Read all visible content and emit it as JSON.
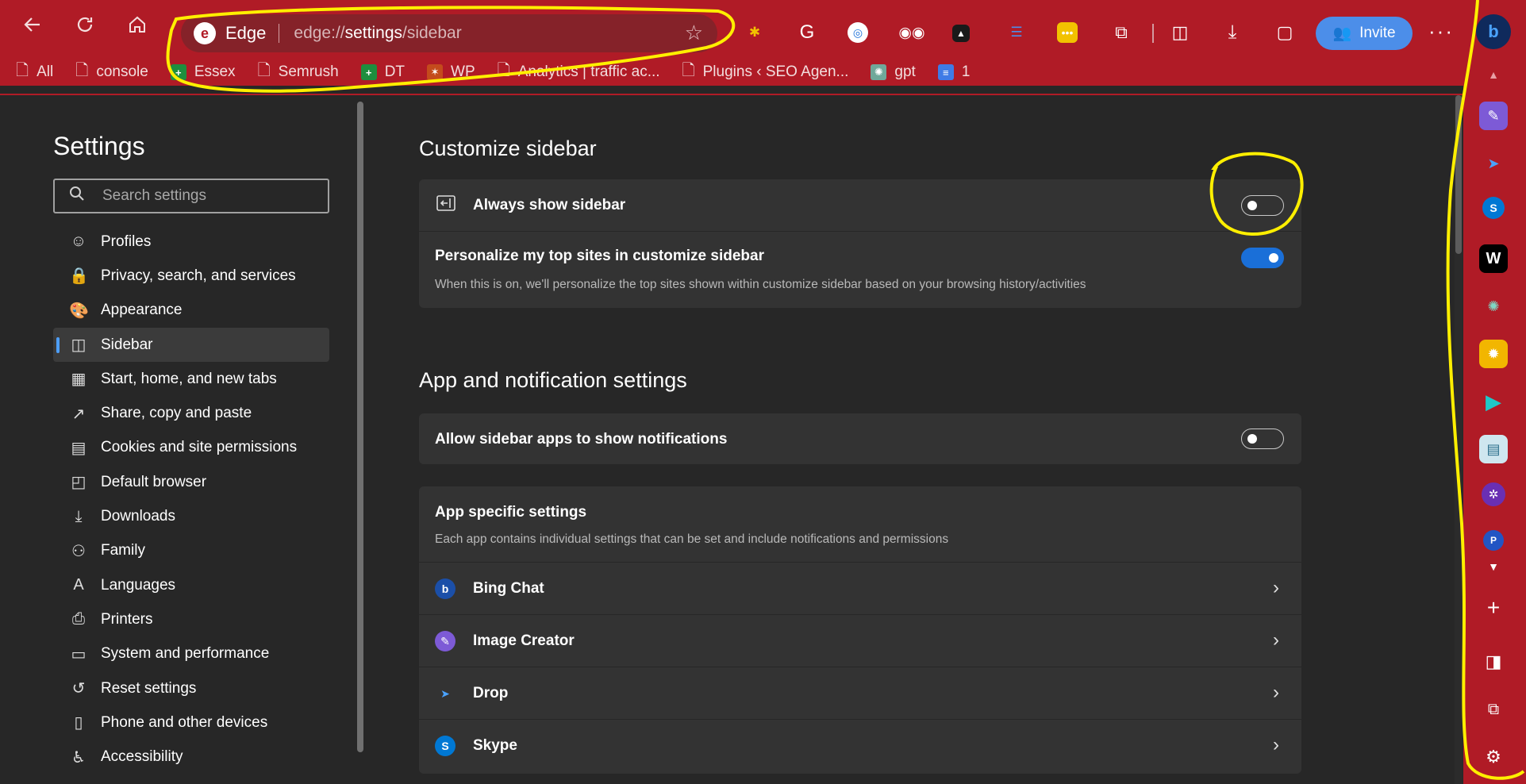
{
  "browser": {
    "brand": "Edge",
    "url_scheme": "edge://",
    "url_host": "settings",
    "url_path": "/sidebar",
    "invite_label": "Invite",
    "more_label": "···"
  },
  "bookmarks": [
    {
      "label": "All",
      "icon": "page-icon"
    },
    {
      "label": "console",
      "icon": "page-icon"
    },
    {
      "label": "Essex",
      "icon": "sheets-icon"
    },
    {
      "label": "Semrush",
      "icon": "page-icon"
    },
    {
      "label": "DT",
      "icon": "sheets-icon"
    },
    {
      "label": "WP",
      "icon": "multicolor-icon"
    },
    {
      "label": "Analytics | traffic ac...",
      "icon": "page-icon"
    },
    {
      "label": "Plugins ‹ SEO Agen...",
      "icon": "page-icon"
    },
    {
      "label": "gpt",
      "icon": "chatgpt-icon"
    },
    {
      "label": "1",
      "icon": "docs-icon"
    }
  ],
  "settings": {
    "title": "Settings",
    "search_placeholder": "Search settings",
    "nav": [
      {
        "label": "Profiles",
        "icon": "profile-icon"
      },
      {
        "label": "Privacy, search, and services",
        "icon": "lock-icon"
      },
      {
        "label": "Appearance",
        "icon": "palette-icon"
      },
      {
        "label": "Sidebar",
        "icon": "sidebar-icon",
        "active": true
      },
      {
        "label": "Start, home, and new tabs",
        "icon": "home-tabs-icon"
      },
      {
        "label": "Share, copy and paste",
        "icon": "share-icon"
      },
      {
        "label": "Cookies and site permissions",
        "icon": "cookies-icon"
      },
      {
        "label": "Default browser",
        "icon": "browser-icon"
      },
      {
        "label": "Downloads",
        "icon": "download-icon"
      },
      {
        "label": "Family",
        "icon": "family-icon"
      },
      {
        "label": "Languages",
        "icon": "languages-icon"
      },
      {
        "label": "Printers",
        "icon": "printer-icon"
      },
      {
        "label": "System and performance",
        "icon": "laptop-icon"
      },
      {
        "label": "Reset settings",
        "icon": "reset-icon"
      },
      {
        "label": "Phone and other devices",
        "icon": "phone-icon"
      },
      {
        "label": "Accessibility",
        "icon": "accessibility-icon"
      }
    ]
  },
  "customize": {
    "title": "Customize sidebar",
    "always_show_label": "Always show sidebar",
    "always_show_on": false,
    "personalize_label": "Personalize my top sites in customize sidebar",
    "personalize_desc": "When this is on, we'll personalize the top sites shown within customize sidebar based on your browsing history/activities",
    "personalize_on": true
  },
  "apps": {
    "title": "App and notification settings",
    "allow_notifications_label": "Allow sidebar apps to show notifications",
    "allow_notifications_on": false,
    "specific_title": "App specific settings",
    "specific_desc": "Each app contains individual settings that can be set and include notifications and permissions",
    "list": [
      {
        "label": "Bing Chat",
        "icon": "bing-icon"
      },
      {
        "label": "Image Creator",
        "icon": "image-creator-icon"
      },
      {
        "label": "Drop",
        "icon": "drop-icon"
      },
      {
        "label": "Skype",
        "icon": "skype-icon"
      }
    ]
  },
  "colors": {
    "chrome": "#b01b26",
    "accent": "#1a6fd8",
    "annotation": "#ffef00"
  }
}
